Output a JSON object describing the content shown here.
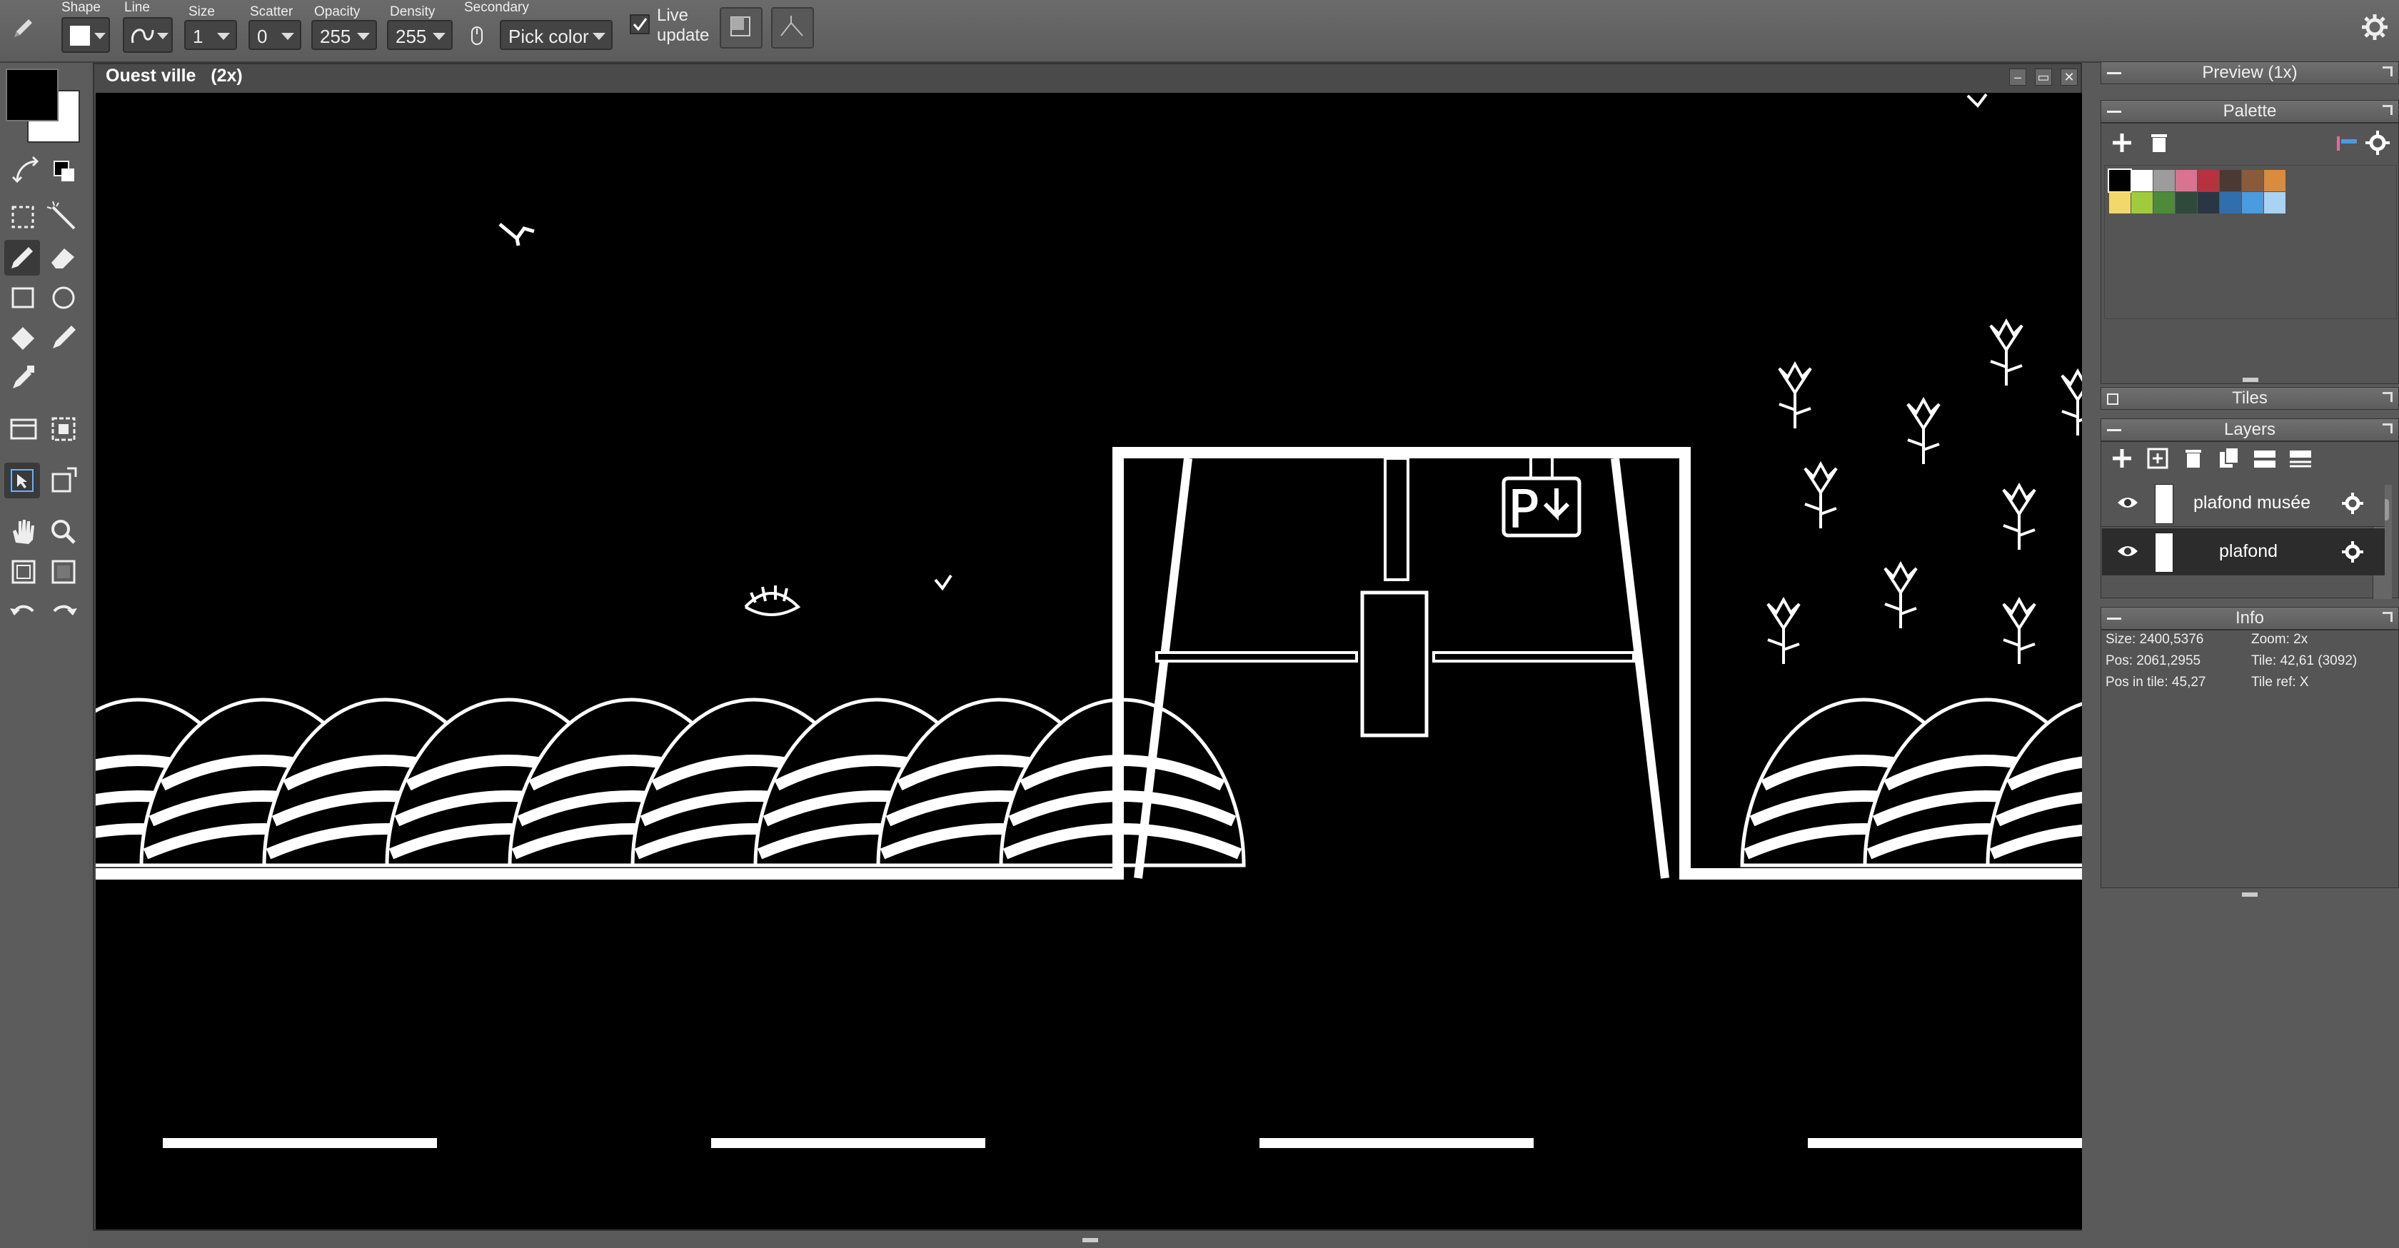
{
  "toolbar": {
    "shape_label": "Shape",
    "line_label": "Line",
    "size_label": "Size",
    "size_value": "1",
    "scatter_label": "Scatter",
    "scatter_value": "0",
    "opacity_label": "Opacity",
    "opacity_value": "255",
    "density_label": "Density",
    "density_value": "255",
    "secondary_label": "Secondary",
    "secondary_value": "Pick color",
    "live_update_line1": "Live",
    "live_update_line2": "update",
    "live_update_checked": true
  },
  "document": {
    "title": "Ouest ville",
    "zoom": "(2x)",
    "minimize_glyph": "–",
    "restore_glyph": "▭",
    "close_glyph": "✕"
  },
  "panels": {
    "preview": {
      "title": "Preview (1x)"
    },
    "palette": {
      "title": "Palette",
      "colors_row1": [
        "#000000",
        "#ffffff",
        "#9c9c9c",
        "#d9738f",
        "#b7323f",
        "#4a3a33",
        "#8a5a3a",
        "#d98b3e"
      ],
      "colors_row2": [
        "#f2d86a",
        "#9fcb3d",
        "#4d8a3a",
        "#2f4a3a",
        "#2a3644",
        "#2f6fae",
        "#4a9be0",
        "#a8d3f2"
      ]
    },
    "tiles": {
      "title": "Tiles"
    },
    "layers": {
      "title": "Layers",
      "items": [
        {
          "name": "plafond musée"
        },
        {
          "name": "plafond"
        }
      ]
    },
    "info": {
      "title": "Info",
      "size": "Size: 2400,5376",
      "zoom": "Zoom: 2x",
      "pos": "Pos: 2061,2955",
      "tile": "Tile: 42,61 (3092)",
      "pos_in_tile": "Pos in tile: 45,27",
      "tile_ref": "Tile ref: X"
    }
  },
  "colors": {
    "primary": "#000000",
    "secondary": "#ffffff"
  },
  "canvas_labels": {
    "parking_letter": "P"
  }
}
